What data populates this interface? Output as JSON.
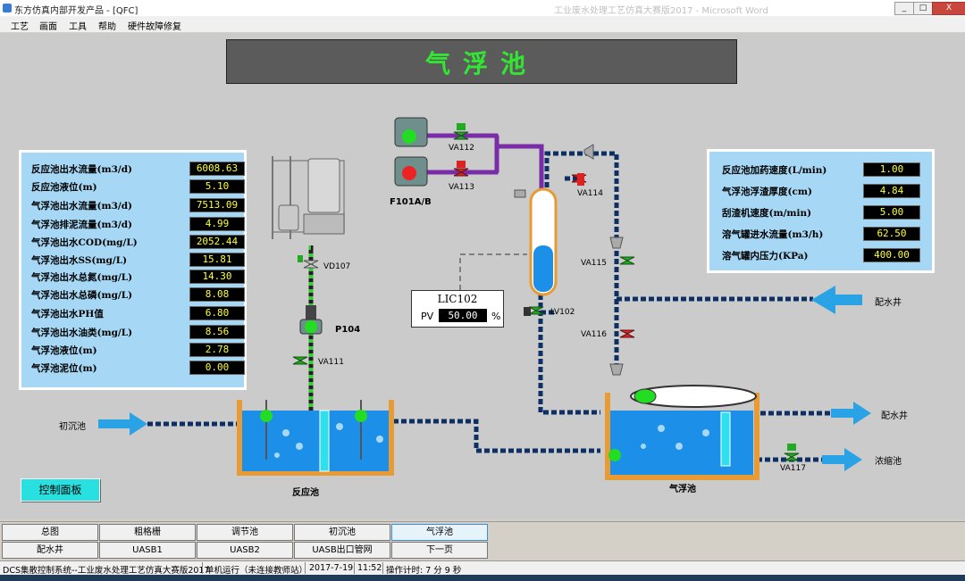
{
  "window": {
    "title": "东方仿真内部开发产品 - [QFC]",
    "faded_title": "工业废水处理工艺仿真大赛版2017 - Microsoft Word",
    "minimize": "_",
    "maximize": "□",
    "close": "X"
  },
  "menu": [
    "工艺",
    "画面",
    "工具",
    "帮助",
    "硬件故障修复"
  ],
  "header": {
    "title": "气浮池"
  },
  "left_panel": [
    {
      "label": "反应池出水流量(m3/d)",
      "value": "6008.63"
    },
    {
      "label": "反应池液位(m)",
      "value": "5.10"
    },
    {
      "label": "气浮池出水流量(m3/d)",
      "value": "7513.09"
    },
    {
      "label": "气浮池排泥流量(m3/d)",
      "value": "4.99"
    },
    {
      "label": "气浮池出水COD(mg/L)",
      "value": "2052.44"
    },
    {
      "label": "气浮池出水SS(mg/L)",
      "value": "15.81"
    },
    {
      "label": "气浮池出水总氮(mg/L)",
      "value": "14.30"
    },
    {
      "label": "气浮池出水总磷(mg/L)",
      "value": "8.08"
    },
    {
      "label": "气浮池出水PH值",
      "value": "6.80"
    },
    {
      "label": "气浮池出水油类(mg/L)",
      "value": "8.56"
    },
    {
      "label": "气浮池液位(m)",
      "value": "2.78"
    },
    {
      "label": "气浮池泥位(m)",
      "value": "0.00"
    }
  ],
  "right_panel": [
    {
      "label": "反应池加药速度(L/min)",
      "value": "1.00"
    },
    {
      "label": "气浮池浮渣厚度(cm)",
      "value": "4.84"
    },
    {
      "label": "刮渣机速度(m/min)",
      "value": "5.00"
    },
    {
      "label": "溶气罐进水流量(m3/h)",
      "value": "62.50"
    },
    {
      "label": "溶气罐内压力(KPa)",
      "value": "400.00"
    }
  ],
  "controller": {
    "tag": "LIC102",
    "pv_label": "PV",
    "pv": "50.00",
    "unit": "%"
  },
  "tags": {
    "va112": "VA112",
    "va113": "VA113",
    "f101": "F101A/B",
    "va114": "VA114",
    "va115": "VA115",
    "va116": "VA116",
    "va117": "VA117",
    "lv102": "LV102",
    "vd107": "VD107",
    "p104": "P104",
    "va111": "VA111"
  },
  "process_labels": {
    "inflow": "初沉池",
    "reaction_tank": "反应池",
    "flotation_tank": "气浮池",
    "dist_well_1": "配水井",
    "dist_well_2": "配水井",
    "thickener": "浓缩池"
  },
  "control_panel_button": "控制面板",
  "nav": {
    "row1": [
      "总图",
      "粗格栅",
      "调节池",
      "初沉池",
      "气浮池"
    ],
    "row2": [
      "配水井",
      "UASB1",
      "UASB2",
      "UASB出口管网",
      "下一页"
    ]
  },
  "status": {
    "system": "DCS集散控制系统--工业废水处理工艺仿真大赛版2017",
    "mode": "单机运行（未连接教师站）",
    "date": "2017-7-19",
    "time": "11:52",
    "elapsed": "操作计时: 7 分 9 秒"
  },
  "colors": {
    "screen_bg": "#cbcbcb",
    "panel": "#a6d8f6",
    "water": "#1c8fe8",
    "tank_wall": "#e89a33",
    "flow_arrow": "#29a3e6",
    "pipe_purple": "#7a2ca8",
    "value_text": "#ffff33",
    "title_green": "#33e633"
  }
}
